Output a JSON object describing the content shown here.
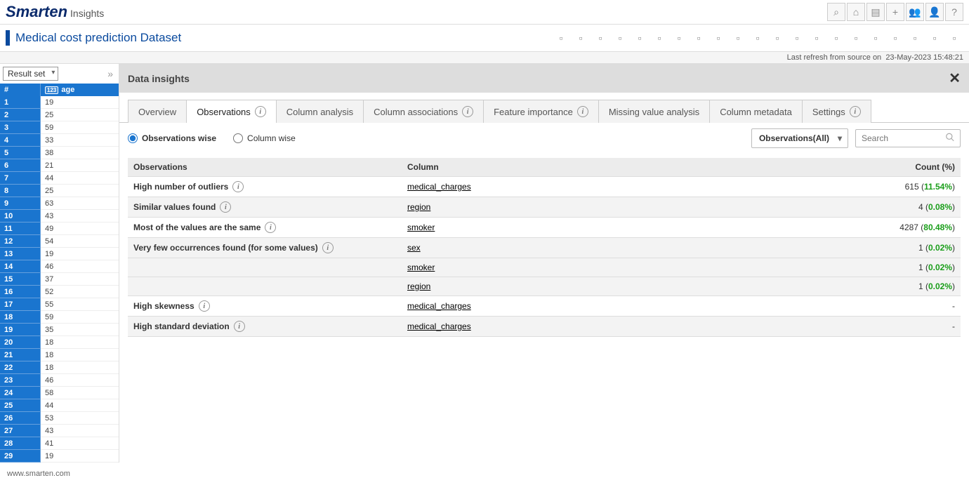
{
  "header": {
    "logo_main": "Smarten",
    "logo_sub": "Insights",
    "icons": [
      "search",
      "home",
      "folder",
      "plus",
      "users",
      "user",
      "help"
    ]
  },
  "page": {
    "title": "Medical cost prediction Dataset",
    "refresh_label": "Last refresh from source on",
    "refresh_value": "23-May-2023 15:48:21"
  },
  "toolbar_icons": [
    "save",
    "play",
    "export",
    "image",
    "db",
    "sheet-out",
    "sheet-in",
    "link",
    "chain",
    "copy",
    "hier",
    "grid",
    "edit2",
    "target",
    "sheet",
    "clip",
    "doc",
    "bars",
    "info",
    "send",
    "comment"
  ],
  "leftpanel": {
    "selector": "Result set",
    "col_num_header": "#",
    "col_age_header": "age",
    "col_type": "123",
    "rows": [
      {
        "n": "1",
        "v": "19"
      },
      {
        "n": "2",
        "v": "25"
      },
      {
        "n": "3",
        "v": "59"
      },
      {
        "n": "4",
        "v": "33"
      },
      {
        "n": "5",
        "v": "38"
      },
      {
        "n": "6",
        "v": "21"
      },
      {
        "n": "7",
        "v": "44"
      },
      {
        "n": "8",
        "v": "25"
      },
      {
        "n": "9",
        "v": "63"
      },
      {
        "n": "10",
        "v": "43"
      },
      {
        "n": "11",
        "v": "49"
      },
      {
        "n": "12",
        "v": "54"
      },
      {
        "n": "13",
        "v": "19"
      },
      {
        "n": "14",
        "v": "46"
      },
      {
        "n": "15",
        "v": "37"
      },
      {
        "n": "16",
        "v": "52"
      },
      {
        "n": "17",
        "v": "55"
      },
      {
        "n": "18",
        "v": "59"
      },
      {
        "n": "19",
        "v": "35"
      },
      {
        "n": "20",
        "v": "18"
      },
      {
        "n": "21",
        "v": "18"
      },
      {
        "n": "22",
        "v": "18"
      },
      {
        "n": "23",
        "v": "46"
      },
      {
        "n": "24",
        "v": "58"
      },
      {
        "n": "25",
        "v": "44"
      },
      {
        "n": "26",
        "v": "53"
      },
      {
        "n": "27",
        "v": "43"
      },
      {
        "n": "28",
        "v": "41"
      },
      {
        "n": "29",
        "v": "19"
      }
    ]
  },
  "insights": {
    "title": "Data insights",
    "tabs": [
      "Overview",
      "Observations",
      "Column analysis",
      "Column associations",
      "Feature importance",
      "Missing value analysis",
      "Column metadata",
      "Settings"
    ],
    "active_tab": 1,
    "tabs_with_info": [
      1,
      3,
      4,
      7
    ],
    "radio_obs": "Observations wise",
    "radio_col": "Column wise",
    "dropdown": "Observations(All)",
    "search_placeholder": "Search",
    "table": {
      "h_obs": "Observations",
      "h_col": "Column",
      "h_count": "Count (%)",
      "rows": [
        {
          "obs": "High number of outliers",
          "info": true,
          "col": "medical_charges",
          "count": "615",
          "pct": "11.54%",
          "alt": false
        },
        {
          "obs": "Similar values found",
          "info": true,
          "col": "region",
          "count": "4",
          "pct": "0.08%",
          "alt": true
        },
        {
          "obs": "Most of the values are the same",
          "info": true,
          "col": "smoker",
          "count": "4287",
          "pct": "80.48%",
          "alt": false
        },
        {
          "obs": "Very few occurrences found (for some values)",
          "info": true,
          "col": "sex",
          "count": "1",
          "pct": "0.02%",
          "alt": true,
          "group_first": true
        },
        {
          "obs": "",
          "info": false,
          "col": "smoker",
          "count": "1",
          "pct": "0.02%",
          "alt": true
        },
        {
          "obs": "",
          "info": false,
          "col": "region",
          "count": "1",
          "pct": "0.02%",
          "alt": true
        },
        {
          "obs": "High skewness",
          "info": true,
          "col": "medical_charges",
          "count": "",
          "pct": "-",
          "alt": false,
          "dash": true
        },
        {
          "obs": "High standard deviation",
          "info": true,
          "col": "medical_charges",
          "count": "",
          "pct": "-",
          "alt": true,
          "dash": true
        }
      ]
    }
  },
  "footer": "www.smarten.com"
}
